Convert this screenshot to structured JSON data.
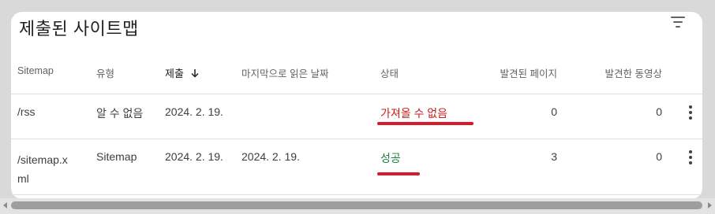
{
  "card": {
    "title": "제출된 사이트맵"
  },
  "icons": {
    "filter": "filter-list-icon",
    "sort": "arrow-down-icon",
    "more": "more-vert-icon"
  },
  "table": {
    "headers": {
      "sitemap": "Sitemap",
      "type": "유형",
      "submitted": "제출",
      "last_read": "마지막으로 읽은 날짜",
      "status": "상태",
      "pages_found": "발견된 페이지",
      "videos_found": "발견한 동영상"
    },
    "rows": [
      {
        "sitemap": "/rss",
        "type": "알 수 없음",
        "submitted": "2024. 2. 19.",
        "last_read": "",
        "status": "가져올 수 없음",
        "pages_found": "0",
        "videos_found": "0"
      },
      {
        "sitemap_line1": "/sitemap.x",
        "sitemap_line2": "ml",
        "type": "Sitemap",
        "submitted": "2024. 2. 19.",
        "last_read": "2024. 2. 19.",
        "status": "성공",
        "pages_found": "3",
        "videos_found": "0"
      }
    ]
  },
  "colors": {
    "status_error": "#c5221f",
    "status_success": "#188038",
    "highlight_underline": "#d9182a"
  }
}
